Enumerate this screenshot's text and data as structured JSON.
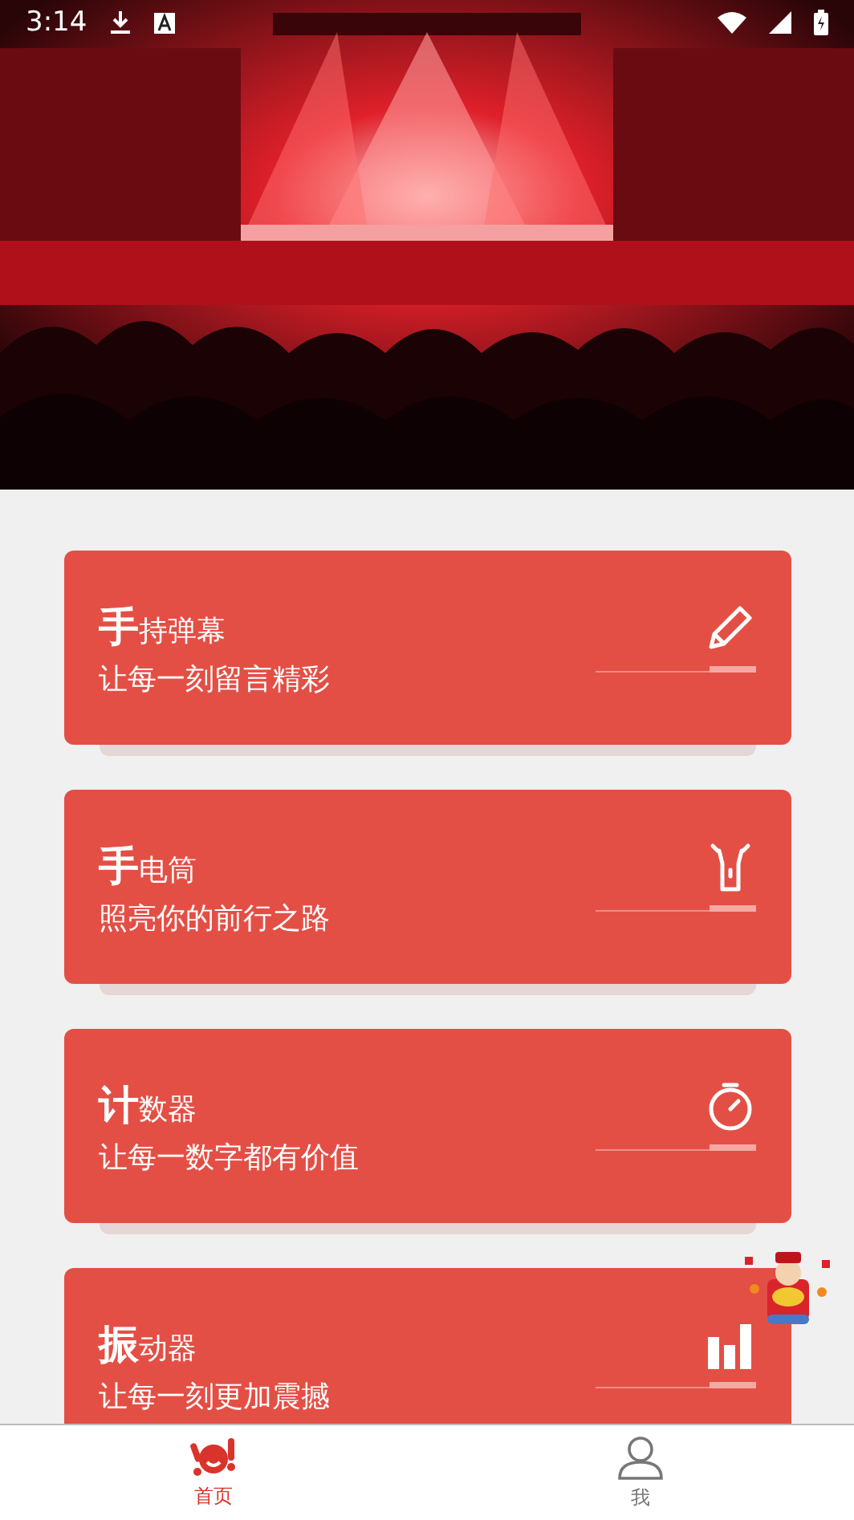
{
  "status_bar": {
    "time": "3:14"
  },
  "cards": [
    {
      "lead": "手",
      "rest": "持弹幕",
      "subtitle": "让每一刻留言精彩",
      "kind": "pencil"
    },
    {
      "lead": "手",
      "rest": "电筒",
      "subtitle": "照亮你的前行之路",
      "kind": "flashlight"
    },
    {
      "lead": "计",
      "rest": "数器",
      "subtitle": "让每一数字都有价值",
      "kind": "stopwatch"
    },
    {
      "lead": "振",
      "rest": "动器",
      "subtitle": "让每一刻更加震撼",
      "kind": "bars"
    }
  ],
  "nav": [
    {
      "label": "首页",
      "selected": true,
      "kind": "home"
    },
    {
      "label": "我",
      "selected": false,
      "kind": "user"
    }
  ]
}
